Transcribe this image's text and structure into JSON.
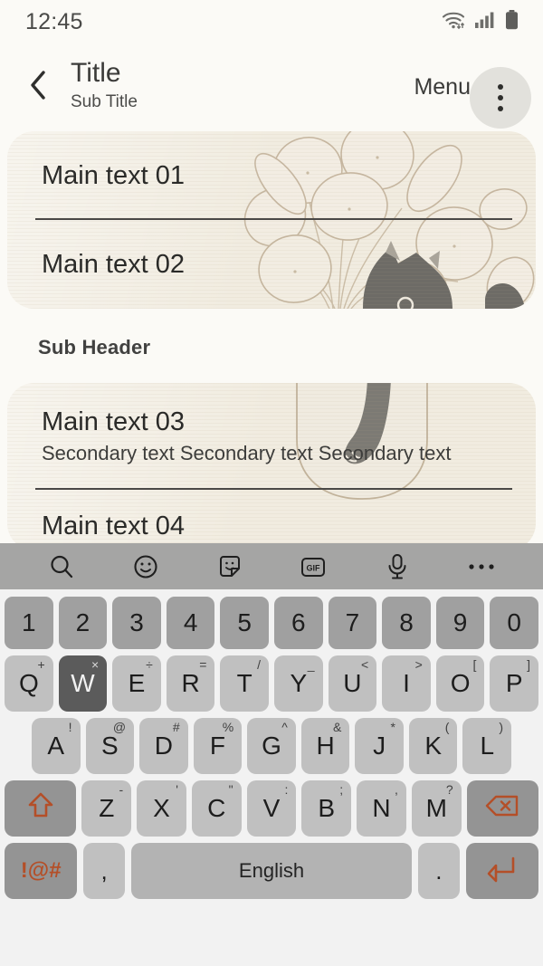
{
  "statusbar": {
    "time": "12:45",
    "icons": [
      "wifi-icon",
      "cellular-signal-icon",
      "battery-icon"
    ]
  },
  "appbar": {
    "back_icon": "chevron-left-icon",
    "title": "Title",
    "subtitle": "Sub Title",
    "menu_label": "Menu",
    "overflow_icon": "more-vertical-icon"
  },
  "content": {
    "card_one": {
      "rows": [
        {
          "main": "Main text 01"
        },
        {
          "main": "Main text 02"
        }
      ]
    },
    "sub_header": "Sub Header",
    "card_two": {
      "rows": [
        {
          "main": "Main text 03",
          "secondary": "Secondary text Secondary text Secondary text"
        },
        {
          "main": "Main text 04"
        }
      ]
    }
  },
  "keyboard": {
    "toolbar": [
      {
        "name": "search-icon",
        "label": "search"
      },
      {
        "name": "emoji-icon",
        "label": "emoji"
      },
      {
        "name": "sticker-icon",
        "label": "sticker"
      },
      {
        "name": "gif-icon",
        "label": "GIF"
      },
      {
        "name": "microphone-icon",
        "label": "voice input"
      },
      {
        "name": "more-horizontal-icon",
        "label": "more"
      }
    ],
    "row_numbers": [
      {
        "key": "1"
      },
      {
        "key": "2"
      },
      {
        "key": "3"
      },
      {
        "key": "4"
      },
      {
        "key": "5"
      },
      {
        "key": "6"
      },
      {
        "key": "7"
      },
      {
        "key": "8"
      },
      {
        "key": "9"
      },
      {
        "key": "0"
      }
    ],
    "row_q": [
      {
        "key": "Q",
        "sup": "+"
      },
      {
        "key": "W",
        "sup": "×",
        "pressed": true
      },
      {
        "key": "E",
        "sup": "÷"
      },
      {
        "key": "R",
        "sup": "="
      },
      {
        "key": "T",
        "sup": "/"
      },
      {
        "key": "Y",
        "sup": "_"
      },
      {
        "key": "U",
        "sup": "<"
      },
      {
        "key": "I",
        "sup": ">"
      },
      {
        "key": "O",
        "sup": "["
      },
      {
        "key": "P",
        "sup": "]"
      }
    ],
    "row_a": [
      {
        "key": "A",
        "sup": "!"
      },
      {
        "key": "S",
        "sup": "@"
      },
      {
        "key": "D",
        "sup": "#"
      },
      {
        "key": "F",
        "sup": "%"
      },
      {
        "key": "G",
        "sup": "^"
      },
      {
        "key": "H",
        "sup": "&"
      },
      {
        "key": "J",
        "sup": "*"
      },
      {
        "key": "K",
        "sup": "("
      },
      {
        "key": "L",
        "sup": ")"
      }
    ],
    "row_z": [
      {
        "key": "Z",
        "sup": "-"
      },
      {
        "key": "X",
        "sup": "'"
      },
      {
        "key": "C",
        "sup": "\""
      },
      {
        "key": "V",
        "sup": ":"
      },
      {
        "key": "B",
        "sup": ";"
      },
      {
        "key": "N",
        "sup": ","
      },
      {
        "key": "M",
        "sup": "?"
      }
    ],
    "shift_icon": "shift-arrow-icon",
    "backspace_icon": "backspace-icon",
    "symbols_key": "!@#",
    "comma_key": ",",
    "space_key": "English",
    "period_key": ".",
    "enter_icon": "enter-return-icon"
  },
  "colors": {
    "page_background": "#fbfaf6",
    "card_background": "#f1ece0",
    "keyboard_background": "#f2f2f2",
    "toolbar_background": "#a5a5a4",
    "key_background": "#c0c0c0",
    "number_key_background": "#a0a0a0",
    "accent_orange": "#b44f28",
    "pressed_key": "#5b5b5b"
  }
}
